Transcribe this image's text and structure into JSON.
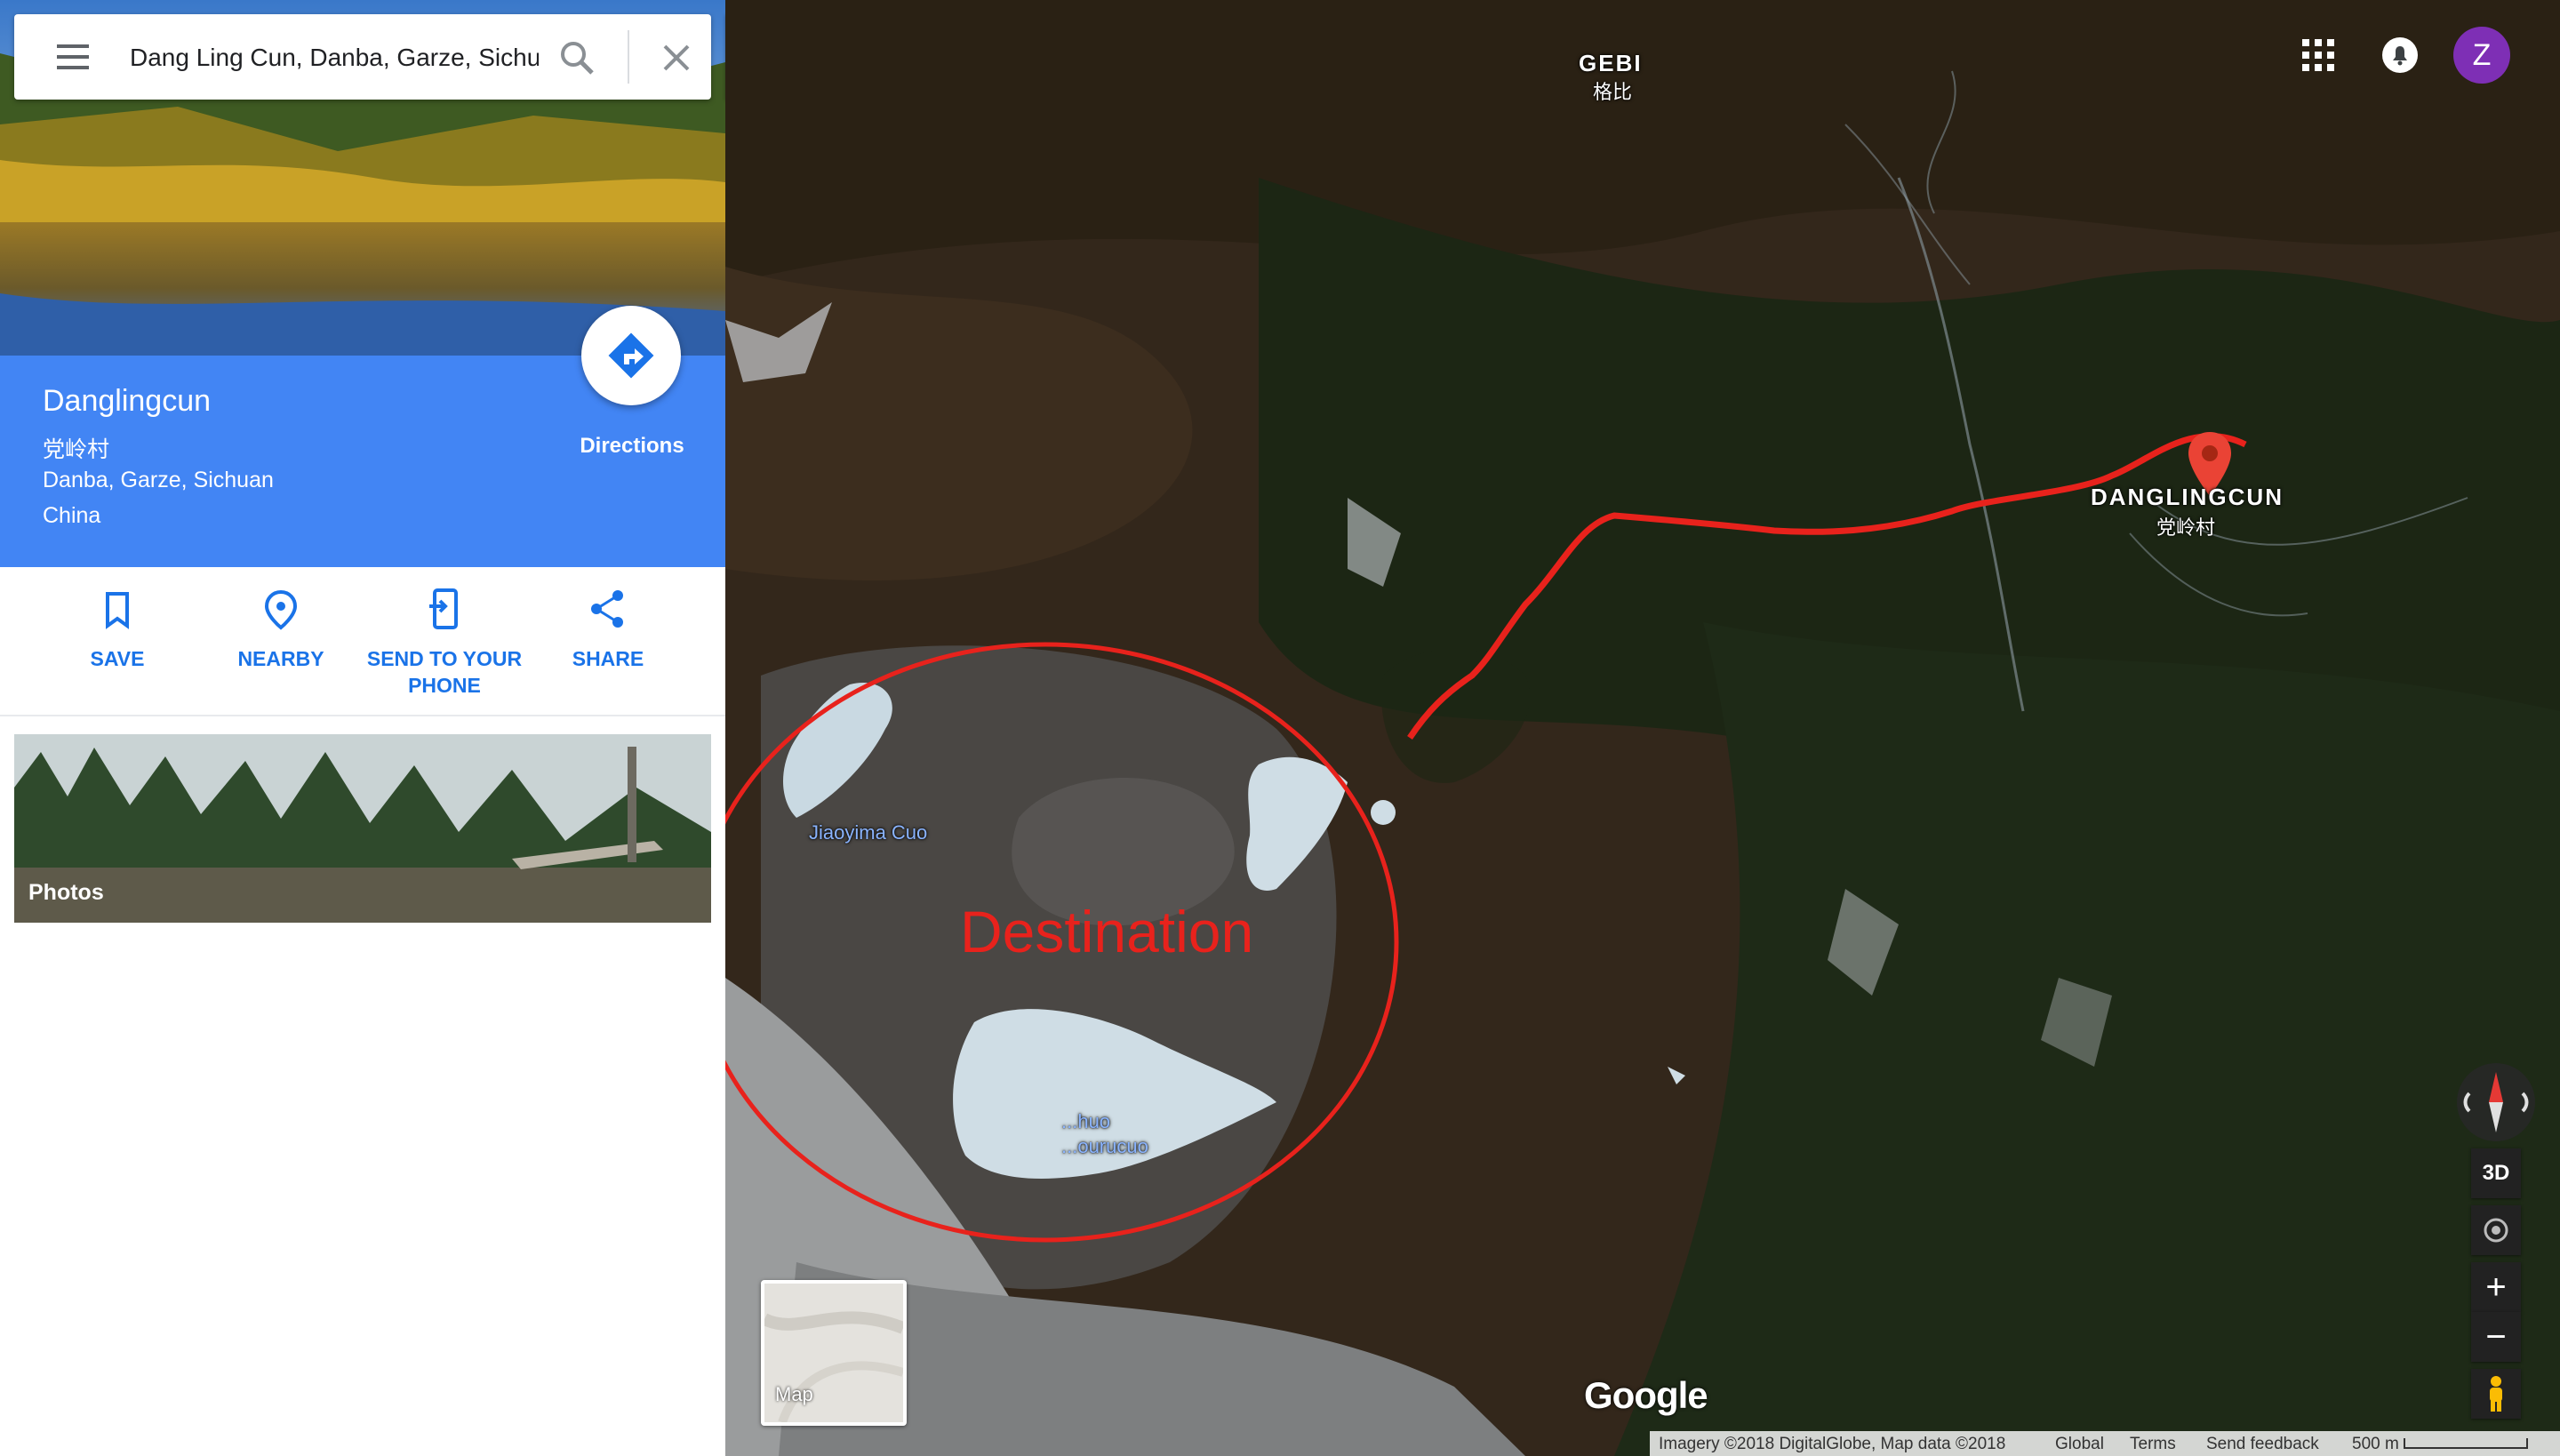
{
  "search": {
    "value": "Dang Ling Cun, Danba, Garze, Sichuan"
  },
  "place": {
    "title": "Danglingcun",
    "native_name": "党岭村",
    "address_line1": "Danba, Garze, Sichuan",
    "address_line2": "China",
    "directions_label": "Directions"
  },
  "actions": [
    {
      "label": "SAVE",
      "icon": "bookmark-icon"
    },
    {
      "label": "NEARBY",
      "icon": "nearby-pin-icon"
    },
    {
      "label": "SEND TO YOUR PHONE",
      "icon": "send-to-phone-icon"
    },
    {
      "label": "SHARE",
      "icon": "share-icon"
    }
  ],
  "photos": {
    "label": "Photos"
  },
  "map": {
    "labels": {
      "gebi": "GEBI",
      "gebi_native": "格比",
      "danglingcun": "DANGLINGCUN",
      "danglingcun_native": "党岭村",
      "lake1": "Jiaoyima Cuo",
      "lake2": "...huo\n...ourucuo"
    },
    "annotation": "Destination",
    "annotation_color": "#e8221c",
    "marker_color": "#ea4335",
    "avatar_letter": "Z",
    "avatar_color": "#7e2fb5",
    "controls": {
      "three_d": "3D",
      "zoom_in": "+",
      "zoom_out": "−"
    },
    "map_toggle": "Map",
    "logo": "Google"
  },
  "footer": {
    "copyright": "Imagery ©2018 DigitalGlobe, Map data ©2018",
    "global": "Global",
    "terms": "Terms",
    "feedback": "Send feedback",
    "scale": "500 m"
  }
}
